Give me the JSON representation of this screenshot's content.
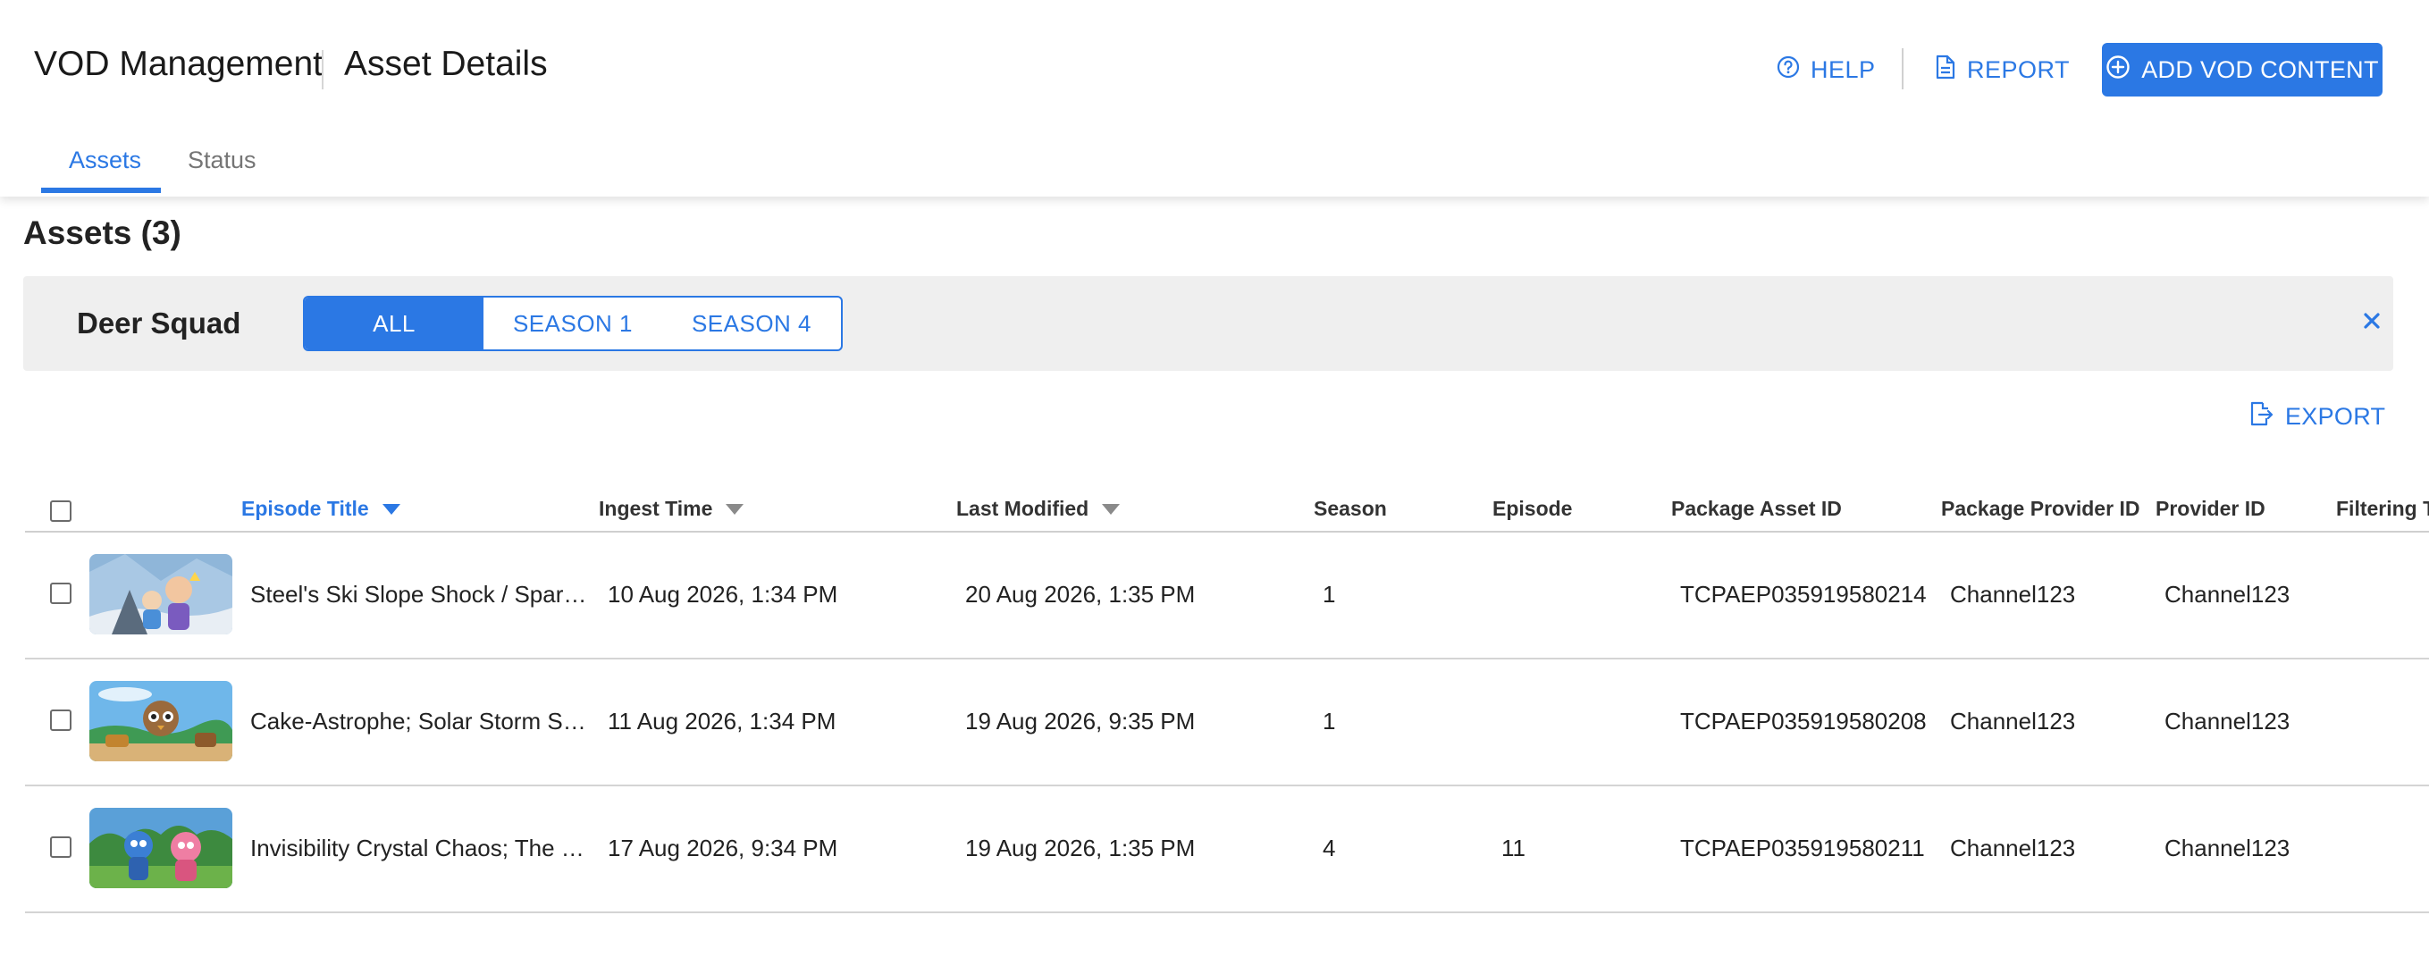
{
  "header": {
    "app_title": "VOD Management",
    "page_title": "Asset Details",
    "help_label": "HELP",
    "report_label": "REPORT",
    "add_label": "ADD VOD CONTENT",
    "accent_color": "#2b78e4"
  },
  "tabs": [
    {
      "label": "Assets",
      "active": true
    },
    {
      "label": "Status",
      "active": false
    }
  ],
  "assets_heading": "Assets (3)",
  "filter": {
    "series_name": "Deer Squad",
    "segments": [
      {
        "label": "ALL",
        "active": true
      },
      {
        "label": "SEASON  1",
        "active": false
      },
      {
        "label": "SEASON  4",
        "active": false
      }
    ]
  },
  "export_label": "EXPORT",
  "table": {
    "columns": [
      "Episode Title",
      "Ingest Time",
      "Last Modified",
      "Season",
      "Episode",
      "Package Asset ID",
      "Package Provider ID",
      "Provider ID",
      "Filtering T"
    ],
    "rows": [
      {
        "title": "Steel's Ski Slope Shock / Spar…",
        "ingest": "10 Aug 2026, 1:34 PM",
        "modified": "20 Aug 2026, 1:35 PM",
        "season": "1",
        "episode": "",
        "package_asset_id": "TCPAEP035919580214",
        "package_provider_id": "Channel123",
        "provider_id": "Channel123",
        "thumb": "snow-scene"
      },
      {
        "title": "Cake-Astrophe; Solar Storm S…",
        "ingest": "11 Aug 2026, 1:34 PM",
        "modified": "19 Aug 2026, 9:35 PM",
        "season": "1",
        "episode": "",
        "package_asset_id": "TCPAEP035919580208",
        "package_provider_id": "Channel123",
        "provider_id": "Channel123",
        "thumb": "desert-scene"
      },
      {
        "title": "Invisibility Crystal Chaos; The …",
        "ingest": "17 Aug 2026, 9:34 PM",
        "modified": "19 Aug 2026, 1:35 PM",
        "season": "4",
        "episode": "11",
        "package_asset_id": "TCPAEP035919580211",
        "package_provider_id": "Channel123",
        "provider_id": "Channel123",
        "thumb": "forest-scene"
      }
    ]
  }
}
